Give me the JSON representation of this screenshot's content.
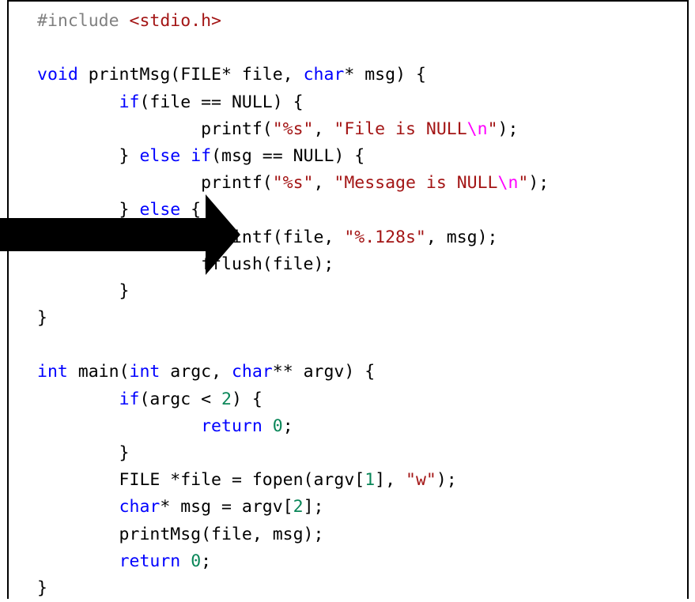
{
  "editor": {
    "lines": [
      [
        {
          "t": "#include ",
          "c": "preproc"
        },
        {
          "t": "<stdio.h>",
          "c": "string"
        }
      ],
      [],
      [
        {
          "t": "void",
          "c": "keyword"
        },
        {
          "t": " printMsg(FILE* file, ",
          "c": "plain"
        },
        {
          "t": "char",
          "c": "keyword"
        },
        {
          "t": "* msg) {",
          "c": "plain"
        }
      ],
      [
        {
          "t": "        ",
          "c": "plain"
        },
        {
          "t": "if",
          "c": "keyword"
        },
        {
          "t": "(file == NULL) {",
          "c": "plain"
        }
      ],
      [
        {
          "t": "                printf(",
          "c": "plain"
        },
        {
          "t": "\"%s\"",
          "c": "string"
        },
        {
          "t": ", ",
          "c": "plain"
        },
        {
          "t": "\"File is NULL",
          "c": "string"
        },
        {
          "t": "\\n",
          "c": "escape"
        },
        {
          "t": "\"",
          "c": "string"
        },
        {
          "t": ");",
          "c": "plain"
        }
      ],
      [
        {
          "t": "        } ",
          "c": "plain"
        },
        {
          "t": "else",
          "c": "keyword"
        },
        {
          "t": " ",
          "c": "plain"
        },
        {
          "t": "if",
          "c": "keyword"
        },
        {
          "t": "(msg == NULL) {",
          "c": "plain"
        }
      ],
      [
        {
          "t": "                printf(",
          "c": "plain"
        },
        {
          "t": "\"%s\"",
          "c": "string"
        },
        {
          "t": ", ",
          "c": "plain"
        },
        {
          "t": "\"Message is NULL",
          "c": "string"
        },
        {
          "t": "\\n",
          "c": "escape"
        },
        {
          "t": "\"",
          "c": "string"
        },
        {
          "t": ");",
          "c": "plain"
        }
      ],
      [
        {
          "t": "        } ",
          "c": "plain"
        },
        {
          "t": "else",
          "c": "keyword"
        },
        {
          "t": " {",
          "c": "plain"
        }
      ],
      [
        {
          "t": "                fprintf(file, ",
          "c": "plain"
        },
        {
          "t": "\"%.128s\"",
          "c": "string"
        },
        {
          "t": ", msg);",
          "c": "plain"
        }
      ],
      [
        {
          "t": "                fflush(file);",
          "c": "plain"
        }
      ],
      [
        {
          "t": "        }",
          "c": "plain"
        }
      ],
      [
        {
          "t": "}",
          "c": "plain"
        }
      ],
      [],
      [
        {
          "t": "int",
          "c": "keyword"
        },
        {
          "t": " main(",
          "c": "plain"
        },
        {
          "t": "int",
          "c": "keyword"
        },
        {
          "t": " argc, ",
          "c": "plain"
        },
        {
          "t": "char",
          "c": "keyword"
        },
        {
          "t": "** argv) {",
          "c": "plain"
        }
      ],
      [
        {
          "t": "        ",
          "c": "plain"
        },
        {
          "t": "if",
          "c": "keyword"
        },
        {
          "t": "(argc < ",
          "c": "plain"
        },
        {
          "t": "2",
          "c": "number"
        },
        {
          "t": ") {",
          "c": "plain"
        }
      ],
      [
        {
          "t": "                ",
          "c": "plain"
        },
        {
          "t": "return",
          "c": "keyword"
        },
        {
          "t": " ",
          "c": "plain"
        },
        {
          "t": "0",
          "c": "number"
        },
        {
          "t": ";",
          "c": "plain"
        }
      ],
      [
        {
          "t": "        }",
          "c": "plain"
        }
      ],
      [
        {
          "t": "        FILE *file = fopen(argv[",
          "c": "plain"
        },
        {
          "t": "1",
          "c": "number"
        },
        {
          "t": "], ",
          "c": "plain"
        },
        {
          "t": "\"w\"",
          "c": "string"
        },
        {
          "t": ");",
          "c": "plain"
        }
      ],
      [
        {
          "t": "        ",
          "c": "plain"
        },
        {
          "t": "char",
          "c": "keyword"
        },
        {
          "t": "* msg = argv[",
          "c": "plain"
        },
        {
          "t": "2",
          "c": "number"
        },
        {
          "t": "];",
          "c": "plain"
        }
      ],
      [
        {
          "t": "        printMsg(file, msg);",
          "c": "plain"
        }
      ],
      [
        {
          "t": "        ",
          "c": "plain"
        },
        {
          "t": "return",
          "c": "keyword"
        },
        {
          "t": " ",
          "c": "plain"
        },
        {
          "t": "0",
          "c": "number"
        },
        {
          "t": ";",
          "c": "plain"
        }
      ],
      [
        {
          "t": "}",
          "c": "plain"
        }
      ]
    ]
  },
  "annotation": {
    "icon": "right-arrow-icon",
    "color": "#000000"
  },
  "colors": {
    "keyword": "#0000ff",
    "string": "#a31515",
    "escape": "#ff00ff",
    "number": "#098658",
    "plain": "#000000",
    "preproc": "#808080"
  }
}
